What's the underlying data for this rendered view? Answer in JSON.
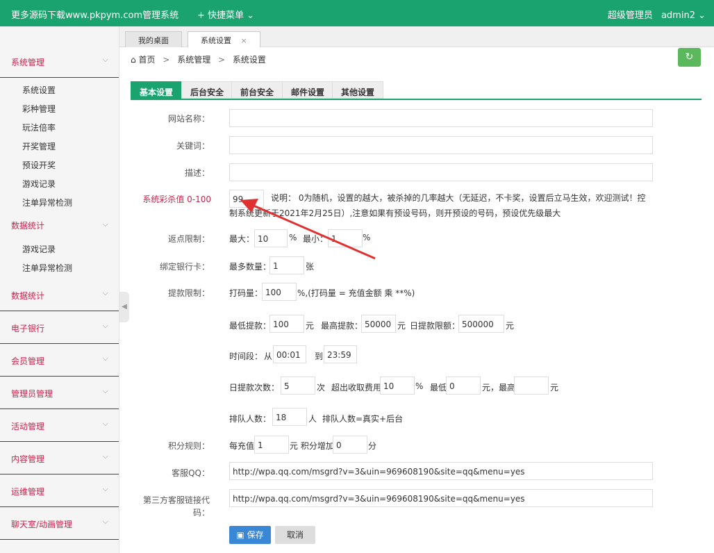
{
  "topbar": {
    "title": "更多源码下载www.pkpym.com管理系统",
    "quick_menu": "+ 快捷菜单 ⌄",
    "role": "超级管理员",
    "username": "admin2 ⌄"
  },
  "sidebar": {
    "groups": [
      {
        "label": "系统管理",
        "items": [
          "系统设置",
          "彩种管理",
          "玩法倍率",
          "开奖管理",
          "预设开奖",
          "游戏记录",
          "注单异常检测"
        ]
      },
      {
        "label": "数据统计",
        "items": [
          "游戏记录",
          "注单异常检测"
        ]
      },
      {
        "label": "数据统计"
      },
      {
        "label": "电子银行"
      },
      {
        "label": "会员管理"
      },
      {
        "label": "管理员管理"
      },
      {
        "label": "活动管理"
      },
      {
        "label": "内容管理"
      },
      {
        "label": "运维管理"
      },
      {
        "label": "聊天室/动画管理"
      }
    ]
  },
  "page_tabs": [
    {
      "label": "我的桌面"
    },
    {
      "label": "系统设置",
      "close": "×"
    }
  ],
  "breadcrumb": {
    "home": "首页",
    "level1": "系统管理",
    "level2": "系统设置",
    "sep": ">"
  },
  "section_tabs": [
    "基本设置",
    "后台安全",
    "前台安全",
    "邮件设置",
    "其他设置"
  ],
  "form": {
    "site_name_label": "网站名称：",
    "keywords_label": "关键词：",
    "description_label": "描述：",
    "kill_rate_label": "系统彩杀值 0-100",
    "kill_rate_value": "99",
    "kill_rate_note": "说明： 0为随机，设置的越大，被杀掉的几率越大（无延迟，不卡奖，设置后立马生效，欢迎测试！控制系统更新于2021年2月25日）,注意如果有预设号码，则开预设的号码，预设优先级最大",
    "rebate_label": "返点限制：",
    "rebate_max_label": "最大：",
    "rebate_max": "10",
    "rebate_min_label": "最小：",
    "rebate_min": "1",
    "percent": "%",
    "bank_label": "绑定银行卡：",
    "bank_max_label": "最多数量：",
    "bank_max": "1",
    "bank_unit": "张",
    "withdraw_label": "提款限制：",
    "turnover_label": "打码量：",
    "turnover": "100",
    "turnover_note": "%,(打码量 = 充值金额 乘 **%)",
    "min_withdraw_label": "最低提款：",
    "min_withdraw": "100",
    "yuan": "元",
    "max_withdraw_label": "最高提款：",
    "max_withdraw": "50000",
    "daily_limit_label": "日提款限额：",
    "daily_limit": "500000",
    "time_label": "时间段：",
    "time_from_label": "从",
    "time_from": "00:01",
    "time_to_label": "到",
    "time_to": "23:59",
    "daily_count_label": "日提款次数：",
    "daily_count": "5",
    "times_unit": "次",
    "over_fee_label": "超出收取费用",
    "over_fee": "10",
    "min_fee_label": "最低",
    "min_fee": "0",
    "max_fee_label": "元，最高",
    "queue_label": "排队人数：",
    "queue": "18",
    "queue_unit": "人",
    "queue_note": "排队人数=真实+后台",
    "points_label": "积分规则：",
    "points_recharge_label": "每充值",
    "points_recharge": "1",
    "points_add_label": "元 积分增加",
    "points_add": "0",
    "points_unit": "分",
    "qq_label": "客服QQ：",
    "qq_url": "http://wpa.qq.com/msgrd?v=3&uin=969608190&site=qq&menu=yes",
    "third_party_label": "第三方客服链接代码：",
    "third_party_url": "http://wpa.qq.com/msgrd?v=3&uin=969608190&site=qq&menu=yes"
  },
  "buttons": {
    "save": "保存",
    "cancel": "取消"
  },
  "colors": {
    "brand": "#1aa36e",
    "save": "#3a87d5",
    "annotation_arrow": "#e03030",
    "menu_text": "#c7254e"
  }
}
